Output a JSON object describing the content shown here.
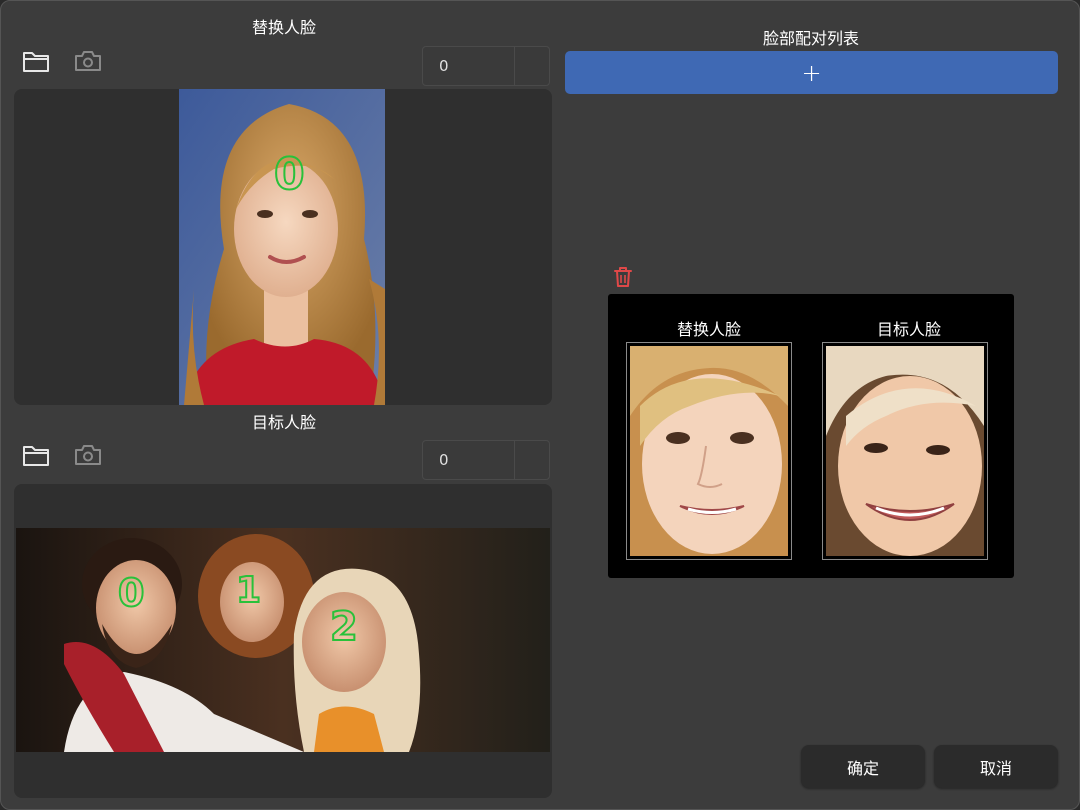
{
  "source_face": {
    "title": "替换人脸",
    "face_index": "0",
    "face_labels": [
      "0"
    ]
  },
  "target_face": {
    "title": "目标人脸",
    "face_index": "0",
    "face_labels": [
      "0",
      "1",
      "2"
    ]
  },
  "pair_list": {
    "title": "脸部配对列表",
    "add_label": "+",
    "pairs": [
      {
        "source_label": "替换人脸",
        "target_label": "目标人脸"
      }
    ]
  },
  "buttons": {
    "ok": "确定",
    "cancel": "取消"
  },
  "icons": {
    "open": "folder-icon",
    "camera": "camera-icon",
    "delete": "trash-icon"
  },
  "colors": {
    "accent": "#3f69b4",
    "face_marker": "#29c13a",
    "delete": "#e04848",
    "background": "#3c3c3c"
  }
}
